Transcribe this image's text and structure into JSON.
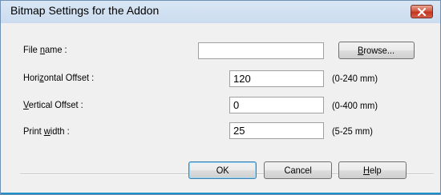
{
  "dialog": {
    "title": "Bitmap Settings for the Addon"
  },
  "fields": {
    "file_name": {
      "label_pre": "File ",
      "label_accel": "n",
      "label_post": "ame :",
      "value": ""
    },
    "horizontal_offset": {
      "label_pre": "Hori",
      "label_accel": "z",
      "label_post": "ontal Offset :",
      "value": "120",
      "range": "(0-240 mm)"
    },
    "vertical_offset": {
      "label_pre": "",
      "label_accel": "V",
      "label_post": "ertical Offset :",
      "value": "0",
      "range": "(0-400 mm)"
    },
    "print_width": {
      "label_pre": "Print ",
      "label_accel": "w",
      "label_post": "idth :",
      "value": "25",
      "range": "(5-25 mm)"
    }
  },
  "buttons": {
    "browse_pre": "",
    "browse_accel": "B",
    "browse_post": "rowse...",
    "ok": "OK",
    "cancel": "Cancel",
    "help_pre": "",
    "help_accel": "H",
    "help_post": "elp"
  },
  "colors": {
    "title_bar": "#cbdcef",
    "dialog_bg": "#f0f0f0",
    "close_button": "#c2351f"
  }
}
